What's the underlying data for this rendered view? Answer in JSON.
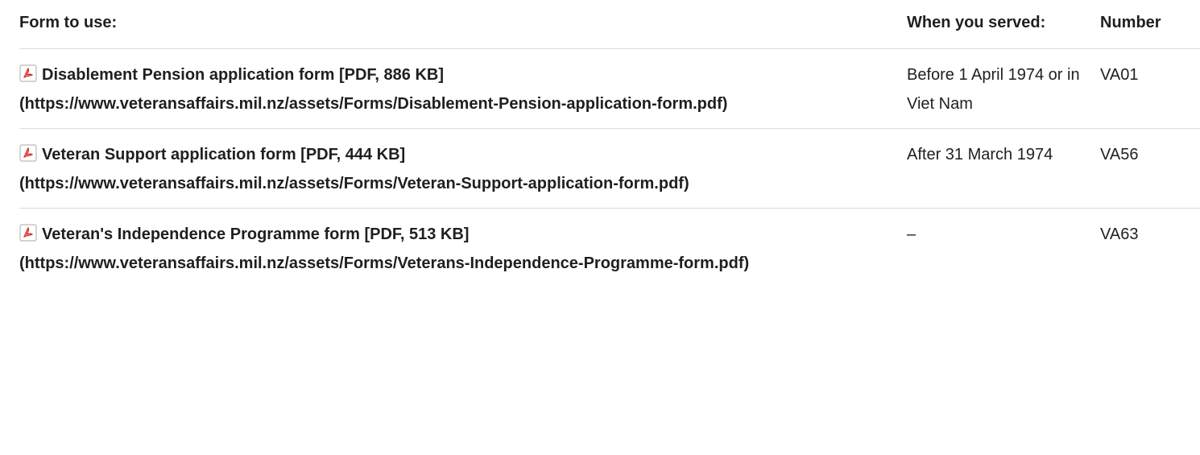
{
  "table": {
    "headers": {
      "form": "Form to use:",
      "served": "When you served:",
      "number": "Number"
    },
    "rows": [
      {
        "form_label": "Disablement Pension application form [PDF, 886 KB]",
        "form_url": "(https://www.veteransaffairs.mil.nz/assets/Forms/Disablement-Pension-application-form.pdf)",
        "served": "Before 1 April 1974 or in Viet Nam",
        "number": "VA01"
      },
      {
        "form_label": "Veteran Support application form [PDF, 444 KB]",
        "form_url": "(https://www.veteransaffairs.mil.nz/assets/Forms/Veteran-Support-application-form.pdf)",
        "served": "After 31 March 1974",
        "number": "VA56"
      },
      {
        "form_label": "Veteran's Independence Programme form [PDF, 513 KB]",
        "form_url": "(https://www.veteransaffairs.mil.nz/assets/Forms/Veterans-Independence-Programme-form.pdf)",
        "served": "–",
        "number": "VA63"
      }
    ]
  },
  "icons": {
    "pdf": "pdf-icon",
    "pdf_color": "#d9302c"
  }
}
